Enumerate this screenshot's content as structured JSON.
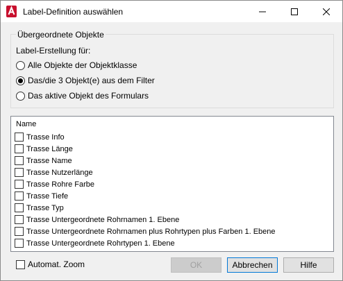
{
  "window": {
    "title": "Label-Definition auswählen",
    "app_icon": "autocad-a-icon",
    "controls": [
      "minimize-icon",
      "maximize-icon",
      "close-icon"
    ]
  },
  "group": {
    "legend": "Übergeordnete Objekte",
    "prompt": "Label-Erstellung für:",
    "options": [
      {
        "label": "Alle Objekte der Objektklasse",
        "selected": false
      },
      {
        "label": "Das/die 3 Objekt(e) aus dem Filter",
        "selected": true
      },
      {
        "label": "Das aktive Objekt des Formulars",
        "selected": false
      }
    ]
  },
  "list": {
    "header": "Name",
    "items": [
      {
        "label": "Trasse Info",
        "checked": false
      },
      {
        "label": "Trasse Länge",
        "checked": false
      },
      {
        "label": "Trasse Name",
        "checked": false
      },
      {
        "label": "Trasse Nutzerlänge",
        "checked": false
      },
      {
        "label": "Trasse Rohre Farbe",
        "checked": false
      },
      {
        "label": "Trasse Tiefe",
        "checked": false
      },
      {
        "label": "Trasse Typ",
        "checked": false
      },
      {
        "label": "Trasse Untergeordnete Rohrnamen 1. Ebene",
        "checked": false
      },
      {
        "label": "Trasse Untergeordnete Rohrnamen plus Rohrtypen plus Farben 1. Ebene",
        "checked": false
      },
      {
        "label": "Trasse Untergeordnete Rohrtypen 1. Ebene",
        "checked": false
      }
    ]
  },
  "footer": {
    "auto_zoom_label": "Automat. Zoom",
    "auto_zoom_checked": false,
    "ok_label": "OK",
    "ok_enabled": false,
    "cancel_label": "Abbrechen",
    "help_label": "Hilfe"
  },
  "colors": {
    "app_icon_red": "#c8102e",
    "focus_border": "#0078d7"
  }
}
